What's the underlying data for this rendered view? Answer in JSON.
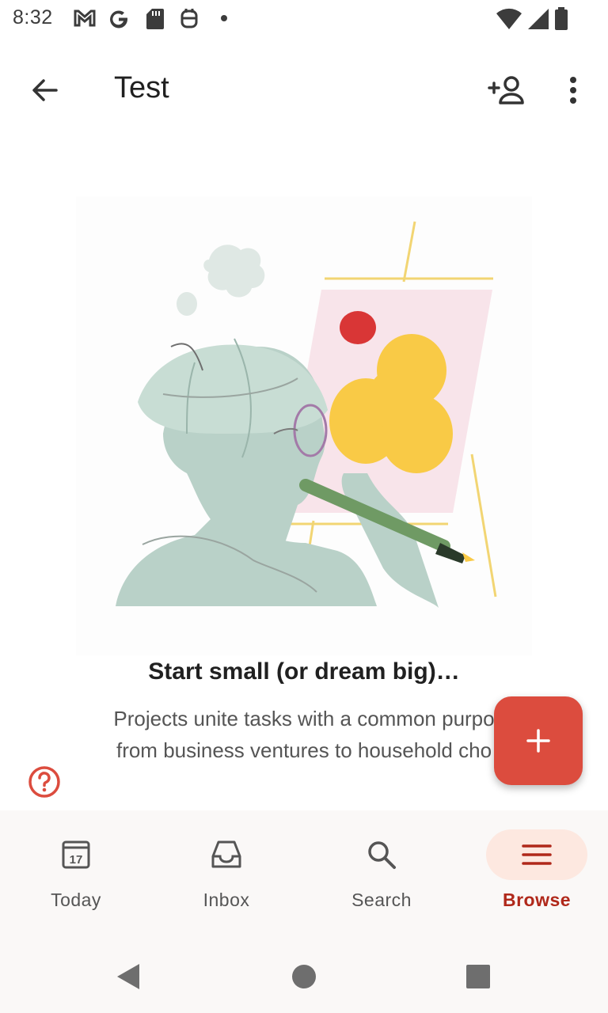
{
  "status_bar": {
    "time": "8:32",
    "icons": [
      "gmail-icon",
      "google-icon",
      "sd-card-icon",
      "assistant-icon",
      "dot-icon",
      "wifi-icon",
      "cell-signal-icon",
      "battery-icon"
    ]
  },
  "app_bar": {
    "title": "Test",
    "icons": [
      "back-arrow-icon",
      "add-person-icon",
      "more-vert-icon"
    ]
  },
  "empty_state": {
    "heading": "Start small (or dream big)…",
    "description_line1": "Projects unite tasks with a common purpo",
    "description_line2": "from business ventures to household cho"
  },
  "fab": {
    "icon": "plus-icon"
  },
  "bottom_nav": {
    "items": [
      {
        "label": "Today",
        "icon": "calendar-icon",
        "calendar_day": "17",
        "active": false
      },
      {
        "label": "Inbox",
        "icon": "inbox-icon",
        "active": false
      },
      {
        "label": "Search",
        "icon": "search-icon",
        "active": false
      },
      {
        "label": "Browse",
        "icon": "menu-icon",
        "active": true
      }
    ]
  },
  "colors": {
    "accent": "#dc4c3e",
    "active_nav_bg": "#fde8e0",
    "active_nav_text": "#b0281a"
  }
}
